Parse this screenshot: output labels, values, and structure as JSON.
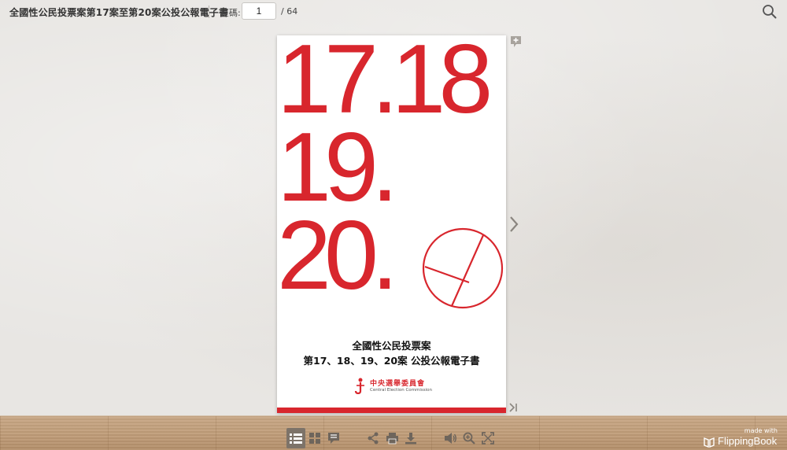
{
  "viewer": {
    "doc_title": "全國性公民投票案第17案至第20案公投公報電子書",
    "page_label": "頁碼:",
    "current_page": "1",
    "page_total": "/  64"
  },
  "cover": {
    "line1": "17.18",
    "line2": "19.",
    "line3": "20.",
    "title_line1": "全國性公民投票案",
    "title_line2": "第17、18、19、20案  公投公報電子書",
    "org_name": "中央選舉委員會",
    "org_name_en": "Central Election Commission"
  },
  "brand": {
    "made_with": "made with",
    "name": "FlippingBook"
  },
  "icons": {
    "search": "search-icon",
    "add_note": "add-note-icon",
    "next_page": "chevron-right-icon",
    "last_page": "last-page-icon",
    "toc": "table-of-contents-icon",
    "thumbnails": "thumbnails-icon",
    "notes": "notes-icon",
    "share": "share-icon",
    "print": "print-icon",
    "download": "download-icon",
    "sound": "sound-icon",
    "zoom": "zoom-in-icon",
    "fullscreen": "fullscreen-icon"
  },
  "colors": {
    "accent_red": "#d8262d",
    "toolbar_icon": "#6e655c",
    "wall": "#e8e6e3",
    "floor": "#c4a17d"
  }
}
